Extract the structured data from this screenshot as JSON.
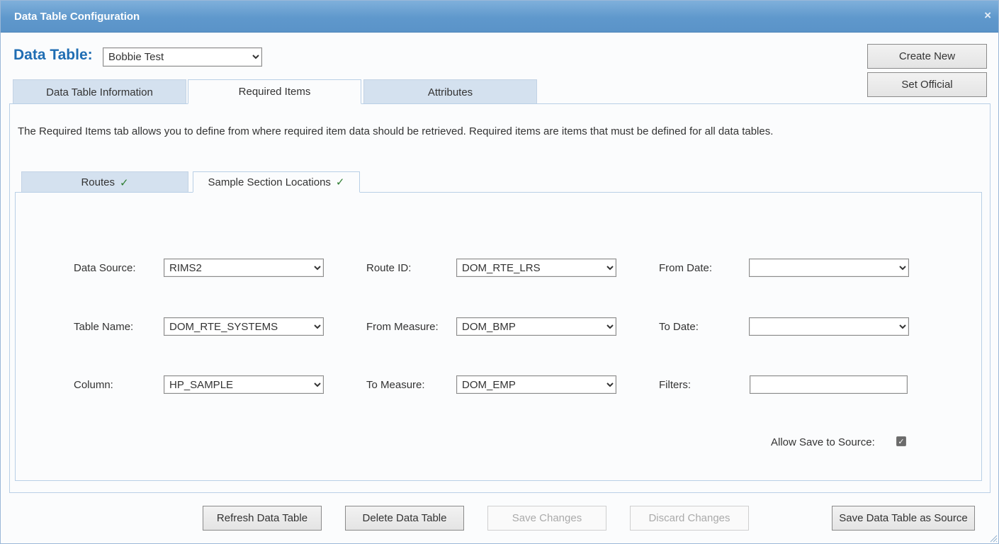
{
  "window": {
    "title": "Data Table Configuration",
    "close_glyph": "×"
  },
  "data_table": {
    "label": "Data Table:",
    "selected": "Bobbie Test"
  },
  "side_buttons": {
    "create_new": "Create New",
    "set_official": "Set Official"
  },
  "tabs": [
    {
      "label": "Data Table Information",
      "active": false
    },
    {
      "label": "Required Items",
      "active": true
    },
    {
      "label": "Attributes",
      "active": false
    }
  ],
  "description": "The Required Items tab allows you to define from where required item data should be retrieved. Required items are items that must be defined for all data tables.",
  "subtabs": [
    {
      "label": "Routes",
      "check": "✓",
      "active": false
    },
    {
      "label": "Sample Section Locations",
      "check": "✓",
      "active": true
    }
  ],
  "form": {
    "data_source": {
      "label": "Data Source:",
      "value": "RIMS2"
    },
    "table_name": {
      "label": "Table Name:",
      "value": "DOM_RTE_SYSTEMS"
    },
    "column": {
      "label": "Column:",
      "value": "HP_SAMPLE"
    },
    "route_id": {
      "label": "Route ID:",
      "value": "DOM_RTE_LRS"
    },
    "from_measure": {
      "label": "From Measure:",
      "value": "DOM_BMP"
    },
    "to_measure": {
      "label": "To Measure:",
      "value": "DOM_EMP"
    },
    "from_date": {
      "label": "From Date:",
      "value": ""
    },
    "to_date": {
      "label": "To Date:",
      "value": ""
    },
    "filters": {
      "label": "Filters:",
      "value": ""
    },
    "allow_save": {
      "label": "Allow Save to Source:",
      "checked": true,
      "glyph": "✓"
    }
  },
  "footer_buttons": {
    "refresh": "Refresh Data Table",
    "delete": "Delete Data Table",
    "save_changes": "Save Changes",
    "discard_changes": "Discard Changes",
    "save_as_source": "Save Data Table as Source"
  },
  "colors": {
    "accent": "#1f6db3",
    "titlebar": "#5f98cc",
    "tab_inactive": "#d4e1ef",
    "check": "#2e7d32"
  }
}
